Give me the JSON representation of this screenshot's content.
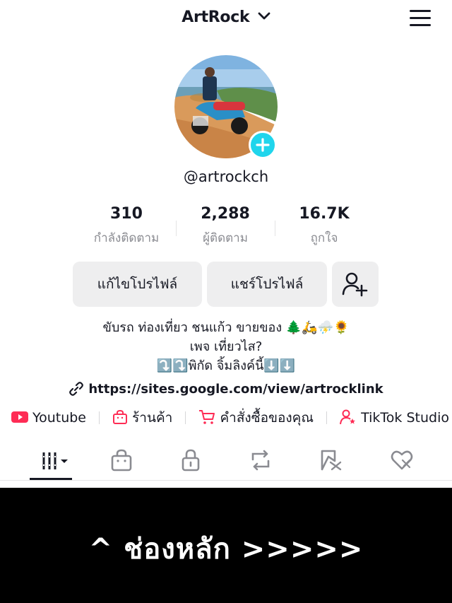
{
  "header": {
    "account_name": "ArtRock"
  },
  "profile": {
    "handle": "@artrockch"
  },
  "stats": [
    {
      "value": "310",
      "label": "กำลังติดตาม"
    },
    {
      "value": "2,288",
      "label": "ผู้ติดตาม"
    },
    {
      "value": "16.7K",
      "label": "ถูกใจ"
    }
  ],
  "actions": {
    "edit_profile": "แก้ไขโปรไฟล์",
    "share_profile": "แชร์โปรไฟล์"
  },
  "bio": {
    "line1": "ขับรถ ท่องเที่ยว ชนแก้ว ขายของ 🌲🛵⛈️🌻",
    "line2": "เพจ เที่ยวไส?",
    "line3": "⤵️⤵️พิกัด จิ้มลิงค์นี้⬇️⬇️"
  },
  "link": {
    "url": "https://sites.google.com/view/artrocklink"
  },
  "shortcuts": [
    {
      "label": "Youtube",
      "icon": "youtube-icon"
    },
    {
      "label": "ร้านค้า",
      "icon": "shop-bag-icon"
    },
    {
      "label": "คำสั่งซื้อของคุณ",
      "icon": "cart-icon"
    },
    {
      "label": "TikTok Studio",
      "icon": "studio-person-icon"
    }
  ],
  "tabs": [
    {
      "icon": "videos-grid-icon",
      "active": true
    },
    {
      "icon": "shop-icon"
    },
    {
      "icon": "lock-icon"
    },
    {
      "icon": "repost-icon"
    },
    {
      "icon": "favorites-icon"
    },
    {
      "icon": "liked-icon"
    }
  ],
  "banner": {
    "text": "^ ช่องหลัก >>>>>"
  },
  "colors": {
    "accent_badge": "#20d5ec",
    "youtube_red": "#fe2c55",
    "banner_bg": "#000000"
  }
}
